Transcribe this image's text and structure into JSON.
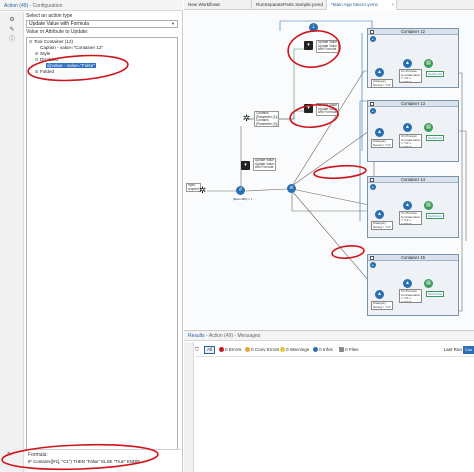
{
  "left_panel": {
    "title": "Action (49)",
    "title_sub": " - Configuration",
    "select_label": "Select an action type",
    "action_type": "Update Value with Formula",
    "attr_label": "Value or Attribute to Update:",
    "tree": [
      {
        "toggle": "⊟",
        "text": "Tool Container (12)",
        "indent": 0,
        "selected": false
      },
      {
        "toggle": "",
        "text": "Caption - value=\"Container 12\"",
        "indent": 1,
        "selected": false
      },
      {
        "toggle": "⊞",
        "text": "Style",
        "indent": 1,
        "selected": false
      },
      {
        "toggle": "⊟",
        "text": "Disabled",
        "indent": 1,
        "selected": false
      },
      {
        "toggle": "",
        "text": "@value - value=\"False\"",
        "indent": 2,
        "selected": true
      },
      {
        "toggle": "⊞",
        "text": "Folded",
        "indent": 1,
        "selected": false
      }
    ],
    "formula_label": "Formula:",
    "formula": "IF Contains([#1], \"C1\") THEN \"False\" ELSE \"True\" ENDIF"
  },
  "tabs": [
    {
      "label": "New Workflow5",
      "active": false
    },
    {
      "label": "RunSeparateParts Sample.yxmd",
      "active": false
    },
    {
      "label": "*Main App Macro.yxmc",
      "active": true
    }
  ],
  "canvas": {
    "containers": [
      "Container 12",
      "Container 13",
      "Container 14",
      "Container 15"
    ],
    "update_anno": "Update Value\nUpdate Value\nwith Formula",
    "condition_anno": "Contains\n[Parameter (1)]\nContains\n[Parameter (2)]",
    "input_label": "Input\nrequest",
    "record_label": "[RecordID] = 1",
    "filter_label": "[Category\nName] = \"C1\"",
    "formula_label": "C1 Process:\nConcatenation\n= \"C1\"+\nFullPath\n=\"Dat\"+\"C1\"\n+[RecordID]\n+\"\"",
    "output_labels": [
      "OutC1.csv",
      "OutC2.csv",
      "OutC3.csv",
      "OutC4.csv"
    ]
  },
  "results": {
    "title": "Results",
    "title_sub": " - Action (49) - Messages",
    "all": "All",
    "errors": "0 Errors",
    "conv_errors": "0 Conv Errors",
    "warnings": "0 Warnings",
    "infos": "0 Infos",
    "files": "0 Files",
    "last_run": "Last Run",
    "conn": "Con"
  },
  "colors": {
    "accent": "#2d5f9a",
    "selection": "#2f6fc0",
    "annotation_red": "#d0141c",
    "tool_blue": "#2a6fb0",
    "tool_orange": "#e58b1b",
    "tool_green": "#3b9b58"
  }
}
